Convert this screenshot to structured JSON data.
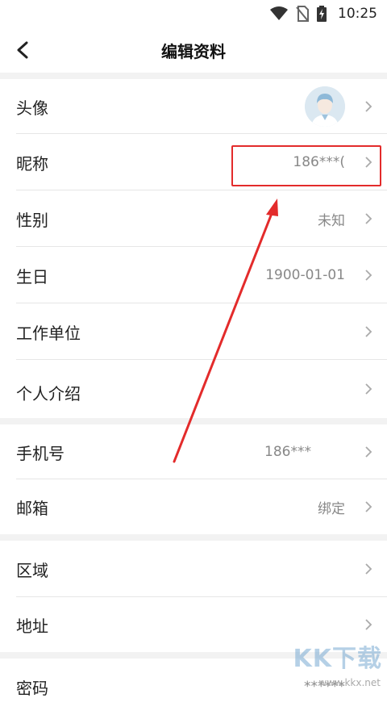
{
  "status_bar": {
    "time": "10:25",
    "icons": [
      "wifi-icon",
      "no-sim-icon",
      "battery-charging-icon"
    ]
  },
  "header": {
    "title": "编辑资料",
    "back_icon": "chevron-left-icon"
  },
  "profile_rows": [
    {
      "label": "头像",
      "value": ""
    },
    {
      "label": "昵称",
      "value": "186***("
    },
    {
      "label": "性别",
      "value": "未知"
    },
    {
      "label": "生日",
      "value": "1900-01-01"
    },
    {
      "label": "工作单位",
      "value": ""
    },
    {
      "label": "个人介绍",
      "value": ""
    }
  ],
  "contact_rows": [
    {
      "label": "手机号",
      "value": "186***"
    },
    {
      "label": "邮箱",
      "value": "绑定"
    }
  ],
  "location_rows": [
    {
      "label": "区域",
      "value": ""
    },
    {
      "label": "地址",
      "value": ""
    }
  ],
  "security_rows": [
    {
      "label": "密码",
      "value": "******"
    }
  ],
  "annotation": {
    "box_color": "#e32b2b",
    "arrow_color": "#e32b2b"
  },
  "watermark": {
    "text": "KK下载",
    "sub": "www.kkx.net"
  }
}
